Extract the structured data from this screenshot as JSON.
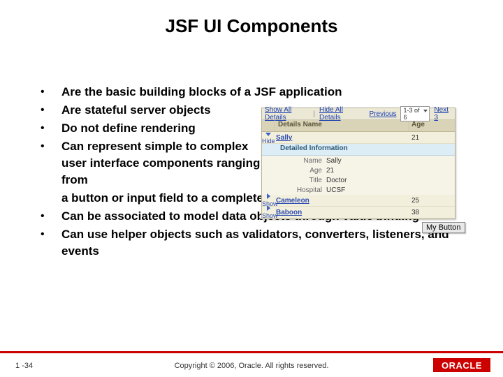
{
  "title": "JSF UI Components",
  "bullets": [
    "Are the basic building blocks of a JSF application",
    "Are stateful server objects",
    "Do not define rendering",
    "Can represent simple to complex user interface components ranging from",
    "a button or input field to a complete page",
    "Can be associated to model data objects through value binding",
    "Can use helper objects such as validators, converters, listeners, and events"
  ],
  "panel": {
    "toolbar": {
      "show_all": "Show All Details",
      "hide_all": "Hide All Details",
      "prev": "Previous",
      "sel": "1-3 of 6",
      "next": "Next 3"
    },
    "header": {
      "name": "Details  Name",
      "age": "Age"
    },
    "master": {
      "name": "Sally",
      "age": "21"
    },
    "section": "Detailed Information",
    "details": [
      {
        "k": "Name",
        "v": "Sally"
      },
      {
        "k": "Age",
        "v": "21"
      },
      {
        "k": "Title",
        "v": "Doctor"
      },
      {
        "k": "Hospital",
        "v": "UCSF"
      }
    ],
    "collapsed": [
      {
        "name": "Cameleon",
        "age": "25"
      },
      {
        "name": "Baboon",
        "age": "38"
      }
    ]
  },
  "button_label": "My Button",
  "footer": {
    "page": "1 -34",
    "copyright": "Copyright © 2006, Oracle. All rights reserved.",
    "logo": "ORACLE"
  }
}
